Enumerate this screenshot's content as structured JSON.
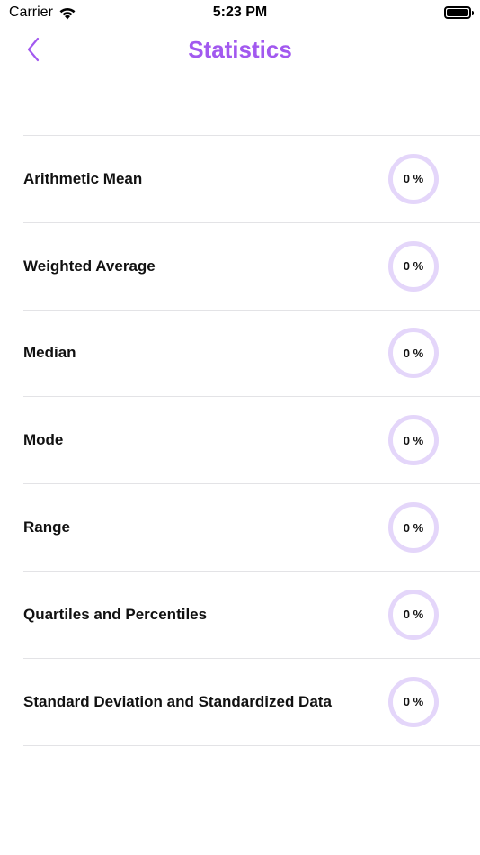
{
  "status_bar": {
    "carrier": "Carrier",
    "time": "5:23 PM"
  },
  "nav": {
    "title": "Statistics",
    "back_icon": "chevron-left-icon"
  },
  "colors": {
    "accent": "#a259ef",
    "ring": "#e4d6fa"
  },
  "topics": [
    {
      "label": "Arithmetic Mean",
      "progress": "0 %"
    },
    {
      "label": "Weighted Average",
      "progress": "0 %"
    },
    {
      "label": "Median",
      "progress": "0 %"
    },
    {
      "label": "Mode",
      "progress": "0 %"
    },
    {
      "label": "Range",
      "progress": "0 %"
    },
    {
      "label": "Quartiles and Percentiles",
      "progress": "0 %"
    },
    {
      "label": "Standard Deviation and Standardized Data",
      "progress": "0 %"
    }
  ]
}
